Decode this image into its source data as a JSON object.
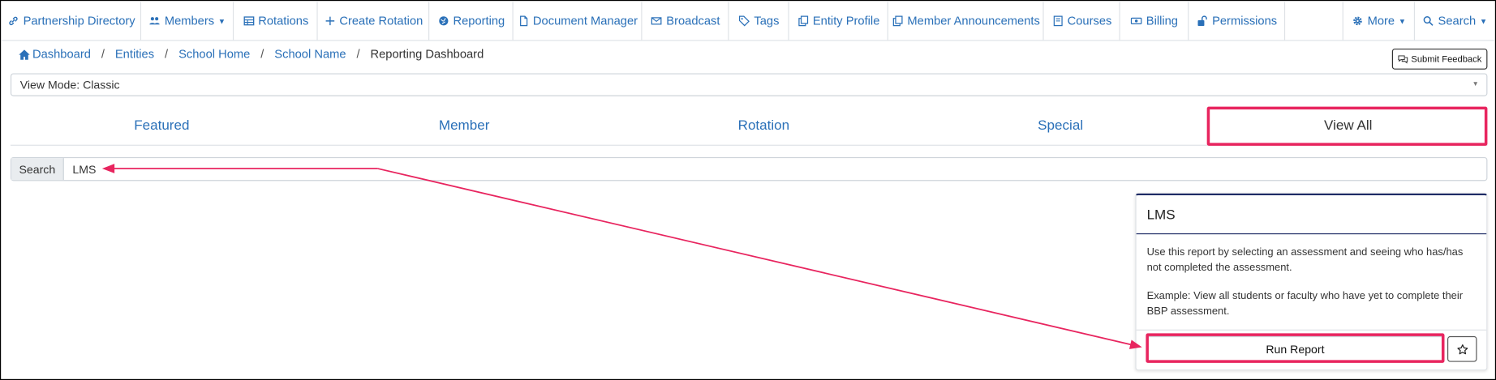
{
  "nav": {
    "items": [
      {
        "label": "Partnership Directory",
        "icon": "link-icon"
      },
      {
        "label": "Members",
        "icon": "users-icon",
        "caret": true
      },
      {
        "label": "Rotations",
        "icon": "table-icon"
      },
      {
        "label": "Create Rotation",
        "icon": "plus-icon"
      },
      {
        "label": "Reporting",
        "icon": "globe-icon"
      },
      {
        "label": "Document Manager",
        "icon": "file-icon"
      },
      {
        "label": "Broadcast",
        "icon": "envelope-icon"
      },
      {
        "label": "Tags",
        "icon": "tag-icon"
      },
      {
        "label": "Entity Profile",
        "icon": "copy-icon"
      },
      {
        "label": "Member Announcements",
        "icon": "copy-icon"
      },
      {
        "label": "Courses",
        "icon": "book-icon"
      },
      {
        "label": "Billing",
        "icon": "money-icon"
      },
      {
        "label": "Permissions",
        "icon": "unlock-icon"
      }
    ],
    "more_label": "More",
    "search_label": "Search"
  },
  "breadcrumb": {
    "items": [
      "Dashboard",
      "Entities",
      "School Home",
      "School Name"
    ],
    "current": "Reporting Dashboard",
    "separator": "/"
  },
  "feedback_button": "Submit Feedback",
  "view_mode": "View Mode: Classic",
  "tabs": [
    {
      "label": "Featured",
      "active": false
    },
    {
      "label": "Member",
      "active": false
    },
    {
      "label": "Rotation",
      "active": false
    },
    {
      "label": "Special",
      "active": false
    },
    {
      "label": "View All",
      "active": true
    }
  ],
  "search": {
    "label": "Search",
    "value": "LMS"
  },
  "report_card": {
    "title": "LMS",
    "description": "Use this report by selecting an assessment and seeing who has/has not completed the assessment.",
    "example": "Example: View all students or faculty who have yet to complete their BBP assessment.",
    "run_label": "Run Report",
    "favorite_icon": "star-icon"
  },
  "colors": {
    "link": "#2a70b8",
    "annotation": "#e8255f",
    "card_accent": "#1f2c66"
  }
}
